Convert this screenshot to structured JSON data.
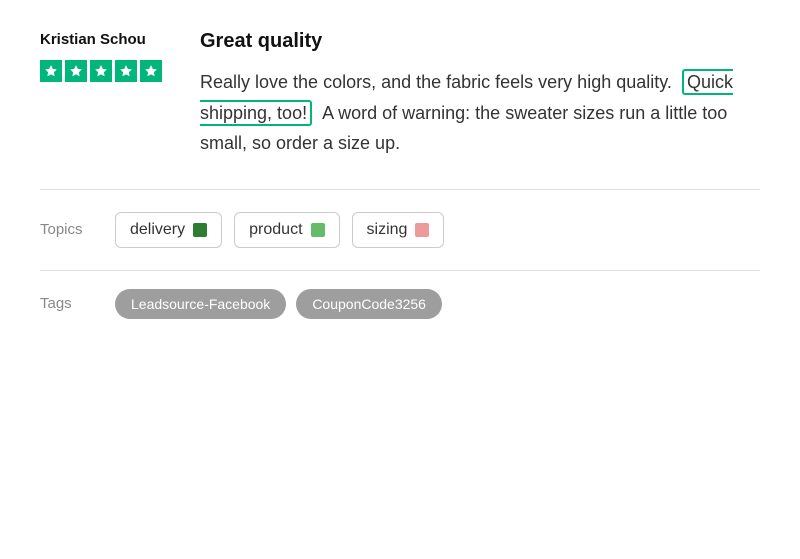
{
  "reviewer": {
    "name": "Kristian Schou",
    "stars_count": 5,
    "stars_color": "#00b67a"
  },
  "review": {
    "title": "Great quality",
    "body_part1": "Really love the colors, and the fabric feels very high quality.",
    "highlighted_text": "Quick shipping, too!",
    "body_part2": "A word of warning: the sweater sizes run a little too small, so order a size up."
  },
  "topics": {
    "label": "Topics",
    "items": [
      {
        "name": "delivery",
        "color": "#2e7d32"
      },
      {
        "name": "product",
        "color": "#66bb6a"
      },
      {
        "name": "sizing",
        "color": "#ef9a9a"
      }
    ]
  },
  "tags": {
    "label": "Tags",
    "items": [
      {
        "name": "Leadsource-Facebook"
      },
      {
        "name": "CouponCode3256"
      }
    ]
  }
}
